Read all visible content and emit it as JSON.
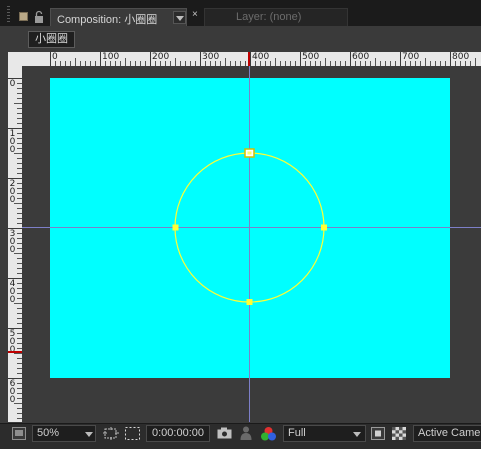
{
  "tabs": {
    "composition_tab": "Composition: 小圈圈",
    "layer_tab": "Layer: (none)",
    "close_glyph": "×"
  },
  "breadcrumb": {
    "comp_name": "小圈圈"
  },
  "rulers": {
    "horizontal_labels": [
      "0",
      "100",
      "200",
      "300",
      "400",
      "500",
      "600",
      "700",
      "800"
    ],
    "vertical_labels": [
      "0",
      "100",
      "200",
      "300",
      "400",
      "500",
      "600"
    ]
  },
  "toolbar": {
    "zoom": "50%",
    "timecode": "0:00:00:00",
    "resolution": "Full",
    "view": "Active Camera"
  },
  "colors": {
    "comp_background": "#00ffff",
    "shape_path": "#ffff33",
    "guide_lines": "#7d7fc8",
    "panel": "#3b3b3b"
  },
  "icons": {
    "tab_label_swatch": "label-color-swatch-icon",
    "tab_lock": "lock-icon",
    "always_preview": "monitor-icon",
    "region_of_interest": "region-of-interest-icon",
    "transparency_grid": "transparency-grid-icon",
    "snapshot": "camera-icon",
    "show_snapshot": "person-icon",
    "channels": "rgb-channels-icon",
    "fast_previews": "fast-preview-icon",
    "toggle_transparency": "checkerboard-icon"
  }
}
